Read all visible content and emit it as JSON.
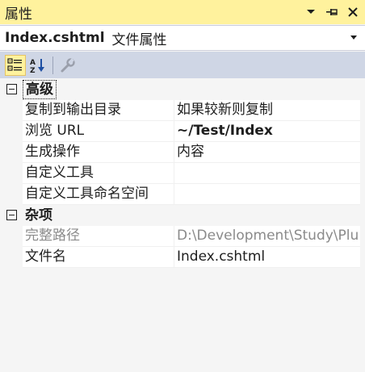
{
  "window": {
    "title": "属性"
  },
  "selector": {
    "object_name": "Index.cshtml",
    "object_type": "文件属性"
  },
  "toolbar": {
    "tools": [
      "categorized-icon",
      "alphabetical-icon",
      "property-pages-icon"
    ]
  },
  "categories": [
    {
      "label": "高级",
      "properties": [
        {
          "name": "复制到输出目录",
          "value": "如果较新则复制",
          "bold": false
        },
        {
          "name": "浏览 URL",
          "value": "~/Test/Index",
          "bold": true
        },
        {
          "name": "生成操作",
          "value": "内容",
          "bold": false
        },
        {
          "name": "自定义工具",
          "value": "",
          "bold": false
        },
        {
          "name": "自定义工具命名空间",
          "value": "",
          "bold": false
        }
      ]
    },
    {
      "label": "杂项",
      "properties": [
        {
          "name": "完整路径",
          "value": "D:\\Development\\Study\\Plu",
          "bold": false,
          "disabled": true
        },
        {
          "name": "文件名",
          "value": "Index.cshtml",
          "bold": false
        }
      ]
    }
  ],
  "colors": {
    "title_bar": "#fff29d",
    "toolbar": "#cfd6e5",
    "disabled_text": "#8a8a8a"
  }
}
